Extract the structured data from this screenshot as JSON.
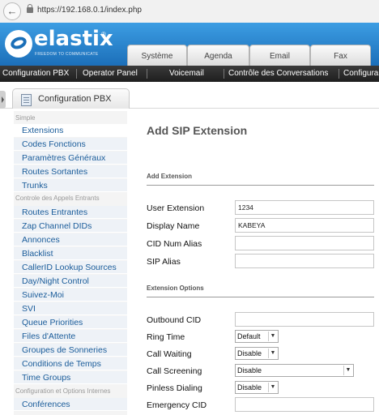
{
  "browser": {
    "back_icon": "arrow-left-icon",
    "url": "https://192.168.0.1/index.php"
  },
  "header": {
    "logo_text": "elastix",
    "logo_reg": "®",
    "tagline": "FREEDOM TO COMMUNICATE",
    "tabs": [
      "Système",
      "Agenda",
      "Email",
      "Fax"
    ]
  },
  "menu": [
    "Configuration PBX",
    "Operator Panel",
    "Voicemail",
    "Contrôle des Conversations",
    "Configura"
  ],
  "module": {
    "title": "Configuration PBX",
    "icon": "document-icon"
  },
  "sidebar": {
    "sections": [
      "Simple",
      "Controle des Appels Entrants",
      "Configuration et Options Internes"
    ],
    "items": [
      "Extensions",
      "Codes Fonctions",
      "Paramètres Généraux",
      "Routes Sortantes",
      "Trunks",
      "Routes Entrantes",
      "Zap Channel DIDs",
      "Annonces",
      "Blacklist",
      "CallerID Lookup Sources",
      "Day/Night Control",
      "Suivez-Moi",
      "SVI",
      "Queue Priorities",
      "Files d'Attente",
      "Groupes de Sonneries",
      "Conditions de Temps",
      "Time Groups",
      "Conférences"
    ]
  },
  "main": {
    "title": "Add SIP Extension",
    "section_add": "Add Extension",
    "section_options": "Extension Options",
    "fields": {
      "user_extension": {
        "label": "User Extension",
        "value": "1234"
      },
      "display_name": {
        "label": "Display Name",
        "value": "KABEYA"
      },
      "cid_num_alias": {
        "label": "CID Num Alias",
        "value": ""
      },
      "sip_alias": {
        "label": "SIP Alias",
        "value": ""
      },
      "outbound_cid": {
        "label": "Outbound CID",
        "value": ""
      },
      "ring_time": {
        "label": "Ring Time",
        "value": "Default"
      },
      "call_waiting": {
        "label": "Call Waiting",
        "value": "Disable"
      },
      "call_screening": {
        "label": "Call Screening",
        "value": "Disable"
      },
      "pinless_dialing": {
        "label": "Pinless Dialing",
        "value": "Disable"
      },
      "emergency_cid": {
        "label": "Emergency CID",
        "value": ""
      }
    }
  },
  "colors": {
    "header_blue": "#2a86d4",
    "menu_dark": "#2b2b2b",
    "link_blue": "#1a5c9a"
  }
}
